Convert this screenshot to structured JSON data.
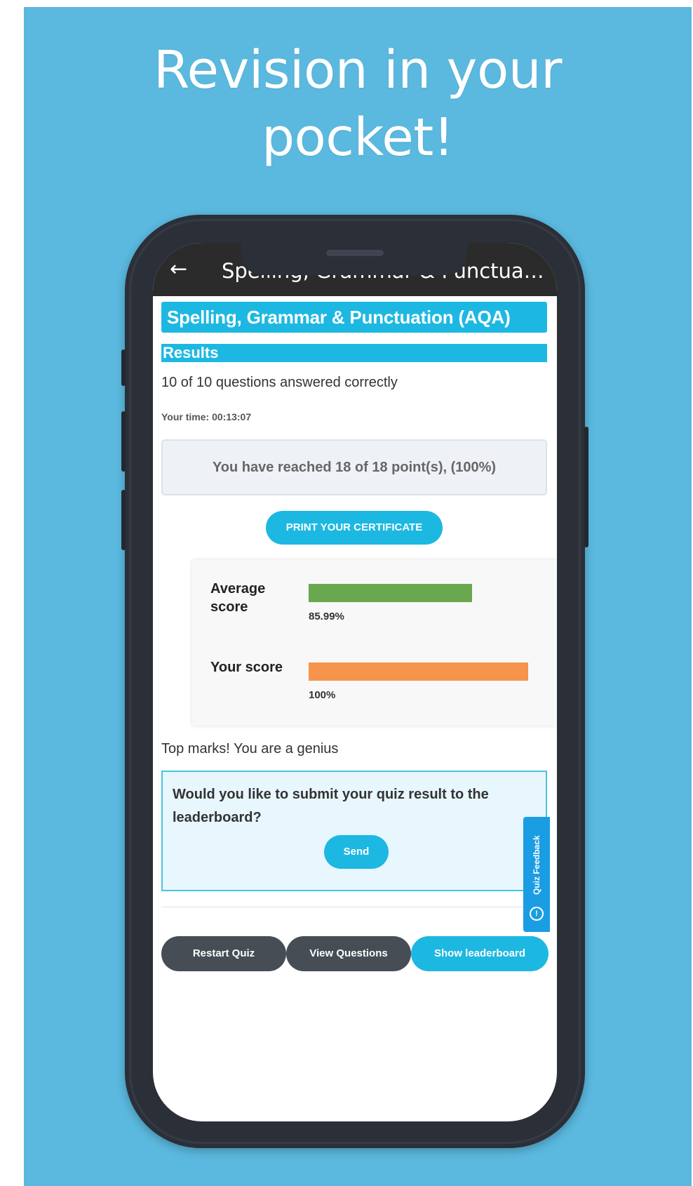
{
  "poster": {
    "headline": "Revision in your\npocket!"
  },
  "appbar": {
    "back_icon": "arrow-left-icon",
    "title": "Spelling, Grammar & Punctuation…"
  },
  "quiz": {
    "title": "Spelling, Grammar & Punctuation (AQA)",
    "results_heading": "Results",
    "answered_text": "10 of 10 questions answered correctly",
    "time_text": "Your time: 00:13:07",
    "points_text": "You have reached 18 of 18 point(s), (100%)",
    "certificate_button": "PRINT YOUR CERTIFICATE"
  },
  "score_chart": {
    "average_label": "Average score",
    "average_value_text": "85.99%",
    "average_value": 85.99,
    "your_label": "Your score",
    "your_value_text": "100%",
    "your_value": 100,
    "max": 100,
    "colors": {
      "average": "#6aa84f",
      "your": "#f5944a"
    }
  },
  "feedback_tab": {
    "label": "Quiz Feedback",
    "icon": "chat-bubble-icon"
  },
  "message": "Top marks! You are a genius",
  "leaderboard": {
    "question": "Would you like to submit your quiz result to the leaderboard?",
    "send_button": "Send"
  },
  "actions": {
    "restart": "Restart Quiz",
    "view_questions": "View Questions",
    "show_leaderboard": "Show leaderboard"
  },
  "colors": {
    "background": "#5bb8de",
    "accent": "#1db8e2",
    "dark_button": "#464d55",
    "appbar": "#2b2b2b"
  }
}
